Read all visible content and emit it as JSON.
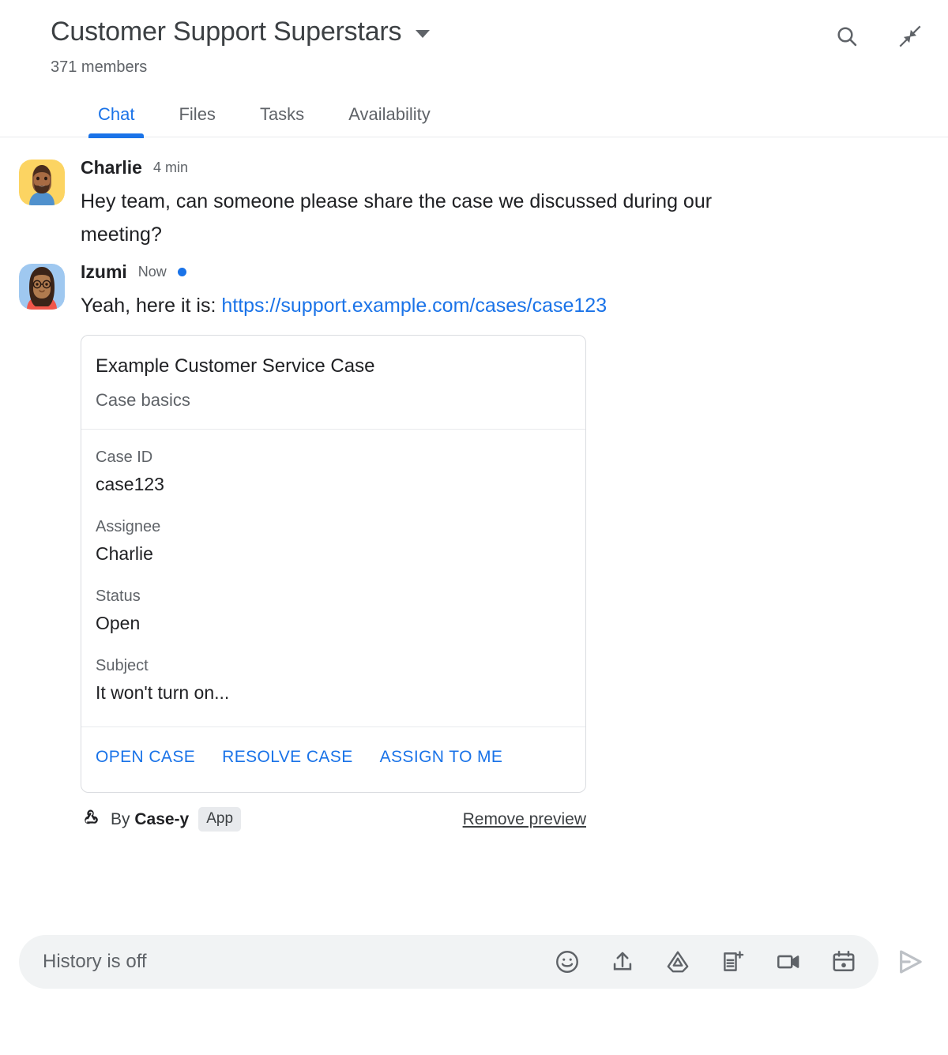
{
  "header": {
    "title": "Customer Support Superstars",
    "members": "371 members",
    "dropdown_icon": "chevron-down-icon",
    "actions": [
      {
        "name": "search-icon",
        "label": "Search"
      },
      {
        "name": "collapse-icon",
        "label": "Collapse"
      }
    ]
  },
  "tabs": [
    {
      "label": "Chat",
      "active": true
    },
    {
      "label": "Files",
      "active": false
    },
    {
      "label": "Tasks",
      "active": false
    },
    {
      "label": "Availability",
      "active": false
    }
  ],
  "messages": [
    {
      "sender": "Charlie",
      "timestamp": "4 min",
      "text": "Hey team, can someone please share the case we discussed during our meeting?",
      "unread": false
    },
    {
      "sender": "Izumi",
      "timestamp": "Now",
      "text_prefix": "Yeah, here it is: ",
      "link": "https://support.example.com/cases/case123",
      "unread": true
    }
  ],
  "card": {
    "title": "Example Customer Service Case",
    "subtitle": "Case basics",
    "fields": [
      {
        "label": "Case ID",
        "value": "case123"
      },
      {
        "label": "Assignee",
        "value": "Charlie"
      },
      {
        "label": "Status",
        "value": "Open"
      },
      {
        "label": "Subject",
        "value": "It won't turn on..."
      }
    ],
    "actions": [
      "OPEN CASE",
      "RESOLVE CASE",
      "ASSIGN TO ME"
    ]
  },
  "attribution": {
    "icon": "webhook-icon",
    "by_text": "By ",
    "app_name": "Case-y",
    "badge": "App",
    "remove_preview": "Remove preview"
  },
  "compose": {
    "placeholder": "History is off",
    "icons": [
      "emoji-icon",
      "upload-icon",
      "google-drive-icon",
      "new-document-icon",
      "video-camera-icon",
      "calendar-icon"
    ],
    "send_icon": "send-icon"
  },
  "colors": {
    "accent": "#1a73e8",
    "text_primary": "#202124",
    "text_secondary": "#5f6368",
    "border": "#dadce0",
    "compose_bg": "#f1f3f4",
    "badge_bg": "#e8eaed"
  }
}
